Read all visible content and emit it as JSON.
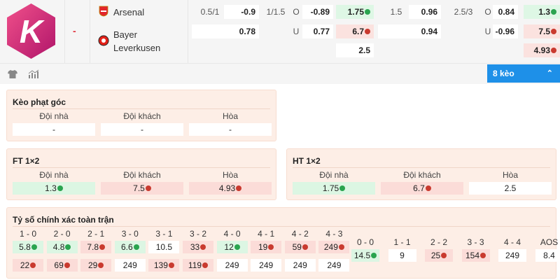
{
  "match": {
    "score_separator": "-",
    "home_team": "Arsenal",
    "away_team_line1": "Bayer",
    "away_team_line2": "Leverkusen",
    "colors": {
      "up": "#def7e5",
      "down": "#fbe2df",
      "accent": "#1e90e8"
    },
    "handicap": {
      "row1": {
        "line": "0.5/1",
        "value": "-0.9"
      },
      "row2": {
        "value": "0.78"
      }
    },
    "over_under": {
      "row1": {
        "line": "1/1.5",
        "side": "O",
        "value": "-0.89"
      },
      "row2": {
        "side": "U",
        "value": "0.77"
      }
    },
    "x12": {
      "home": "1.75",
      "home_trend": "up",
      "away": "6.7",
      "away_trend": "down",
      "draw": "2.5"
    },
    "handicap_ht": {
      "row1": {
        "line": "1.5",
        "value": "0.96"
      },
      "row2": {
        "value": "0.94"
      }
    },
    "over_under_ht": {
      "row1": {
        "line": "2.5/3",
        "side": "O",
        "value": "0.84"
      },
      "row2": {
        "side": "U",
        "value": "-0.96"
      }
    },
    "x12_ht": {
      "home": "1.3",
      "home_trend": "up",
      "away": "7.5",
      "away_trend": "down",
      "draw": "4.93"
    }
  },
  "toolbar": {
    "shirt_icon": "shirt-icon",
    "stats_icon": "stats-icon",
    "more_label": "8 kèo",
    "chevron_icon": "chevron-up-icon"
  },
  "corner": {
    "title": "Kèo phạt góc",
    "labels": [
      "Đội nhà",
      "Đội khách",
      "Hòa"
    ],
    "values": [
      "-",
      "-",
      "-"
    ]
  },
  "ft": {
    "title": "FT 1×2",
    "labels": [
      "Đội nhà",
      "Đội khách",
      "Hòa"
    ],
    "values": [
      "1.3",
      "7.5",
      "4.93"
    ],
    "trends": [
      "up",
      "down",
      "down"
    ]
  },
  "ht": {
    "title": "HT 1×2",
    "labels": [
      "Đội nhà",
      "Đội khách",
      "Hòa"
    ],
    "values": [
      "1.75",
      "6.7",
      "2.5"
    ],
    "trends": [
      "up",
      "down",
      "none"
    ]
  },
  "correct_score": {
    "title": "Tỷ số chính xác toàn trận",
    "home_wins": [
      {
        "score": "1 - 0",
        "home_val": "5.8",
        "home_trend": "up",
        "away_val": "22",
        "away_trend": "down"
      },
      {
        "score": "2 - 0",
        "home_val": "4.8",
        "home_trend": "up",
        "away_val": "69",
        "away_trend": "down"
      },
      {
        "score": "2 - 1",
        "home_val": "7.8",
        "home_trend": "down",
        "away_val": "29",
        "away_trend": "down"
      },
      {
        "score": "3 - 0",
        "home_val": "6.6",
        "home_trend": "up",
        "away_val": "249",
        "away_trend": "none"
      },
      {
        "score": "3 - 1",
        "home_val": "10.5",
        "home_trend": "none",
        "away_val": "139",
        "away_trend": "down"
      },
      {
        "score": "3 - 2",
        "home_val": "33",
        "home_trend": "down",
        "away_val": "119",
        "away_trend": "down"
      },
      {
        "score": "4 - 0",
        "home_val": "12",
        "home_trend": "up",
        "away_val": "249",
        "away_trend": "none"
      },
      {
        "score": "4 - 1",
        "home_val": "19",
        "home_trend": "down",
        "away_val": "249",
        "away_trend": "none"
      },
      {
        "score": "4 - 2",
        "home_val": "59",
        "home_trend": "down",
        "away_val": "249",
        "away_trend": "none"
      },
      {
        "score": "4 - 3",
        "home_val": "249",
        "home_trend": "down",
        "away_val": "249",
        "away_trend": "none"
      }
    ],
    "draws": [
      {
        "score": "0 - 0",
        "val": "14.5",
        "trend": "up"
      },
      {
        "score": "1 - 1",
        "val": "9",
        "trend": "none"
      },
      {
        "score": "2 - 2",
        "val": "25",
        "trend": "down"
      },
      {
        "score": "3 - 3",
        "val": "154",
        "trend": "down"
      },
      {
        "score": "4 - 4",
        "val": "249",
        "trend": "none"
      },
      {
        "score": "AOS",
        "val": "8.4",
        "trend": "none"
      }
    ]
  }
}
